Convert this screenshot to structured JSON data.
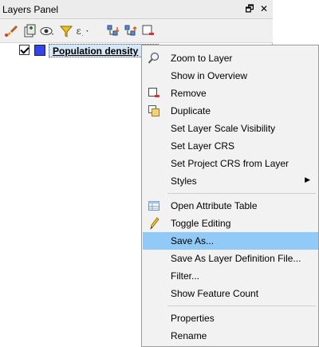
{
  "panel": {
    "title": "Layers Panel",
    "float_btn": "🗗",
    "close_btn": "✕"
  },
  "toolbar": {
    "icons": [
      "paint-brush-icon",
      "add-group-icon",
      "eye-icon",
      "filter-icon",
      "filter-expression-icon",
      "expand-all-icon",
      "collapse-all-icon",
      "remove-layer-icon"
    ]
  },
  "layer": {
    "name": "Population density",
    "color": "#3344ee"
  },
  "menu": {
    "items": [
      {
        "label": "Zoom to Layer",
        "icon": "zoom-icon"
      },
      {
        "label": "Show in Overview"
      },
      {
        "label": "Remove",
        "icon": "remove-icon"
      },
      {
        "label": "Duplicate",
        "icon": "duplicate-icon"
      },
      {
        "label": "Set Layer Scale Visibility"
      },
      {
        "label": "Set Layer CRS"
      },
      {
        "label": "Set Project CRS from Layer"
      },
      {
        "label": "Styles",
        "submenu": true
      },
      {
        "label": "Open Attribute Table",
        "icon": "table-icon"
      },
      {
        "label": "Toggle Editing",
        "icon": "pencil-icon"
      },
      {
        "label": "Save As...",
        "highlighted": true
      },
      {
        "label": "Save As Layer Definition File..."
      },
      {
        "label": "Filter..."
      },
      {
        "label": "Show Feature Count"
      },
      {
        "label": "Properties"
      },
      {
        "label": "Rename"
      }
    ]
  }
}
